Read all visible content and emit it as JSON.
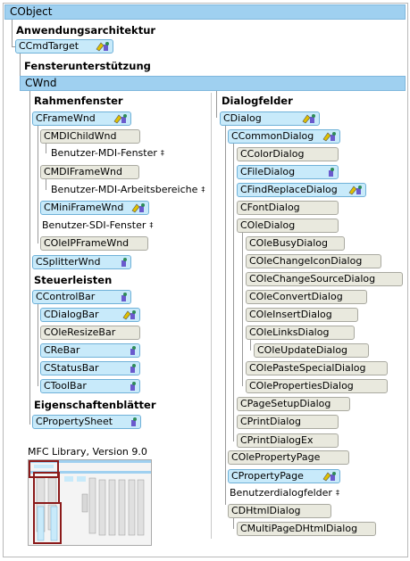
{
  "root": "CObject",
  "sections": {
    "arch": "Anwendungsarchitektur",
    "window_support": "Fensterunterstützung",
    "frame_windows": "Rahmenfenster",
    "dialog_boxes": "Dialogfelder",
    "control_bars": "Steuerleisten",
    "property_sheets": "Eigenschaftenblätter"
  },
  "nodes": {
    "ccmdtarget": "CCmdTarget",
    "cwnd": "CWnd",
    "cframewnd": "CFrameWnd",
    "cmdichildwnd": "CMDIChildWnd",
    "user_mdi_windows": "Benutzer-MDI-Fenster",
    "cmdiframewnd": "CMDIFrameWnd",
    "user_mdi_workspaces": "Benutzer-MDI-Arbeitsbereiche",
    "cminiframewnd": "CMiniFrameWnd",
    "user_sdi_windows": "Benutzer-SDI-Fenster",
    "coleipframewnd": "COleIPFrameWnd",
    "csplitterwnd": "CSplitterWnd",
    "ccontrolbar": "CControlBar",
    "cdialogbar": "CDialogBar",
    "coleresizebar": "COleResizeBar",
    "crebar": "CReBar",
    "cstatusbar": "CStatusBar",
    "ctoolbar": "CToolBar",
    "cpropertysheet": "CPropertySheet",
    "cdialog": "CDialog",
    "ccommondialog": "CCommonDialog",
    "ccolordialog": "CColorDialog",
    "cfiledialog": "CFileDialog",
    "cfindreplacedialog": "CFindReplaceDialog",
    "cfontdialog": "CFontDialog",
    "coledialog": "COleDialog",
    "colebusydialog": "COleBusyDialog",
    "colechangeicondialog": "COleChangeIconDialog",
    "colechangesourcedialog": "COleChangeSourceDialog",
    "coleconvertdialog": "COleConvertDialog",
    "coleinsertdialog": "COleInsertDialog",
    "colelinksdialog": "COleLinksDialog",
    "coleupdatedialog": "COleUpdateDialog",
    "colepastespecialdialog": "COlePasteSpecialDialog",
    "colepropertiesdialog": "COlePropertiesDialog",
    "cpagesetupdialog": "CPageSetupDialog",
    "cprintdialog": "CPrintDialog",
    "cprintdialogex": "CPrintDialogEx",
    "colepropertypage": "COlePropertyPage",
    "cpropertypage": "CPropertyPage",
    "user_dialogs": "Benutzerdialogfelder",
    "chtmldialog": "CDHtmlDialog",
    "cmultipagedhtmldialog": "CMultiPageDHtmlDialog"
  },
  "dagger": "‡",
  "thumbnail_label": "MFC Library, Version 9.0",
  "colors": {
    "bar": "#9fd0f0",
    "blue_node": "#c8eafa",
    "gray_node": "#e9e9de",
    "highlight": "#8b1a1a"
  }
}
